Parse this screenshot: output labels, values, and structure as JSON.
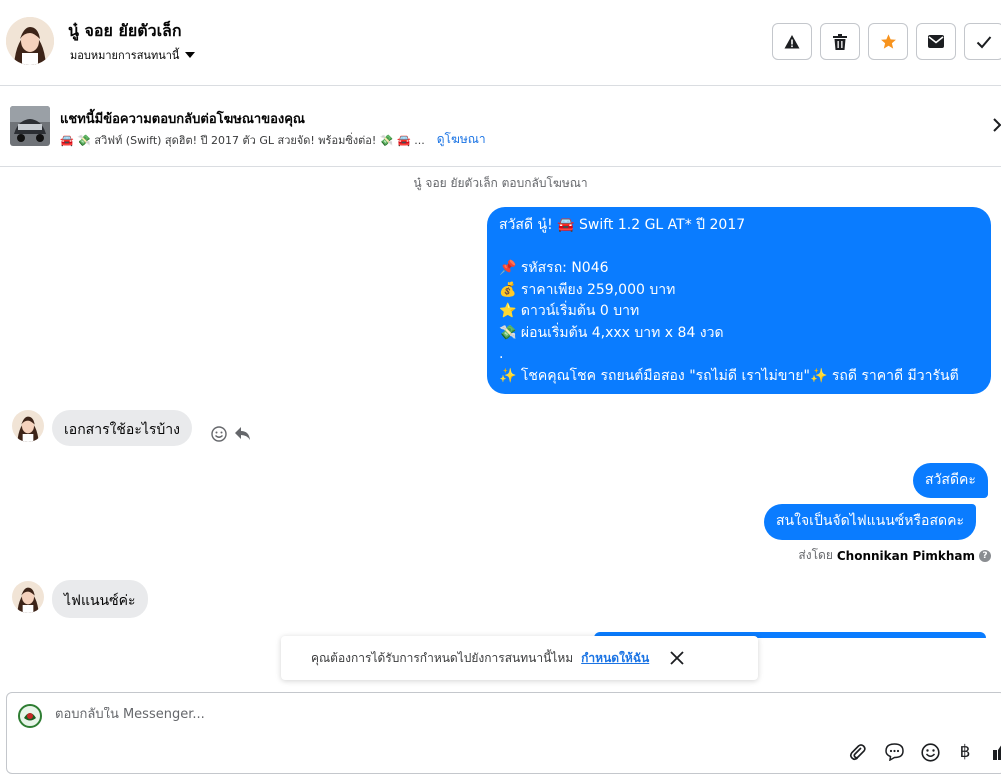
{
  "header": {
    "contact_name": "นู๋ จอย ยัยตัวเล็ก",
    "assign_label": "มอบหมายการสนทนานี้"
  },
  "ad_banner": {
    "title": "แชทนี้มีข้อความตอบกลับต่อโฆษณาของคุณ",
    "preview": "🚘 💸 สวิฟท์ (Swift) สุดฮิต! ปี 2017 ตัว GL สวยจัด! พร้อมซิ่งต่อ! 💸 🚘 ...",
    "view_ad_link": "ดูโฆษณา"
  },
  "chat": {
    "system_note": "นู๋ จอย ยัยตัวเล็ก ตอบกลับโฆษณา",
    "first_message_lines": [
      "สวัสดี นู๋! 🚘 Swift 1.2 GL AT* ปี 2017",
      "",
      "📌 รหัสรถ: N046",
      "💰 ราคาเพียง 259,000 บาท",
      "⭐ ดาวน์เริ่มต้น 0 บาท",
      "💸 ผ่อนเริ่มต้น 4,xxx บาท x 84 งวด",
      ".",
      "✨ โชคคุณโชค รถยนต์มือสอง \"รถไม่ดี เราไม่ขาย\"✨ รถดี ราคาดี มีวารันตี"
    ],
    "incoming_1": "เอกสารใช้อะไรบ้าง",
    "outgoing_2": "สวัสดีคะ",
    "outgoing_3": "สนใจเป็นจัดไฟแนนซ์หรือสดคะ",
    "sent_by_label": "ส่งโดย",
    "sent_by_name": "Chonnikan Pimkham",
    "incoming_2": "ไฟแนนซ์ค่ะ"
  },
  "toast": {
    "text": "คุณต้องการได้รับการกำหนดไปยังการสนทนานี้ไหม",
    "link": "กำหนดให้ฉัน"
  },
  "composer": {
    "placeholder": "ตอบกลับใน Messenger..."
  },
  "colors": {
    "outgoing_bubble": "#0a7cff",
    "incoming_bubble": "#e9eaec",
    "link": "#1b74e4",
    "star": "#f7931e"
  }
}
